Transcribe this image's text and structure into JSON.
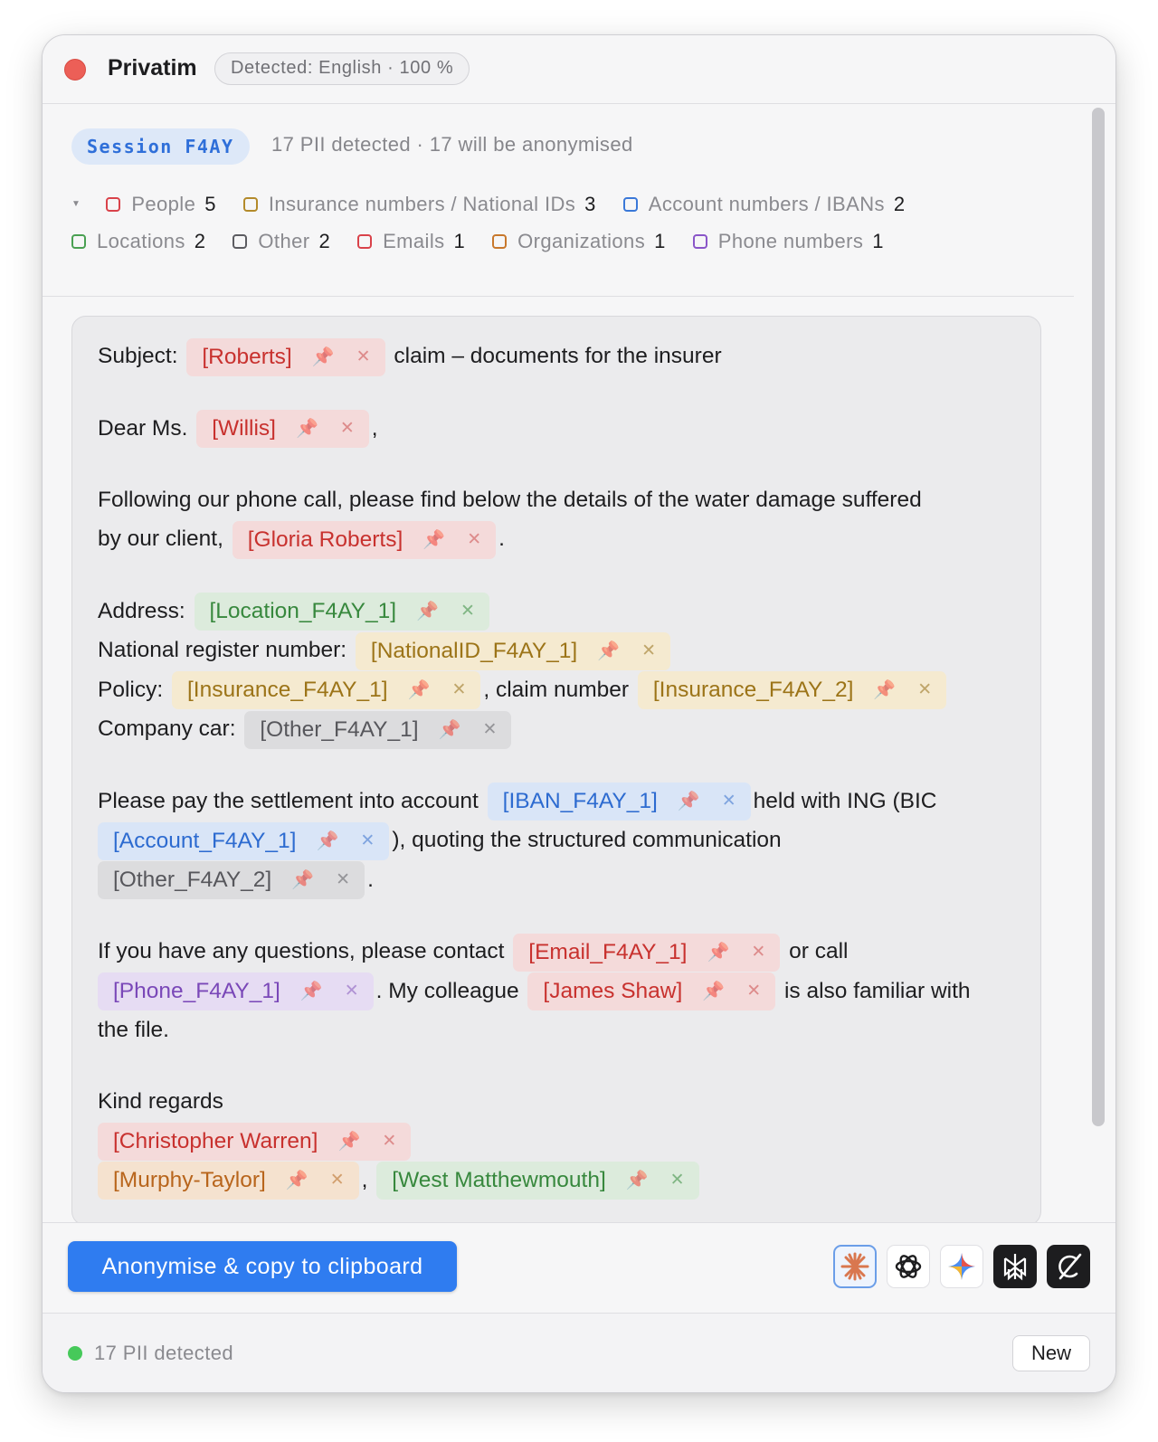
{
  "app": {
    "title": "Privatim",
    "detected": "Detected: English · 100 %"
  },
  "session": {
    "label": "Session F4AY",
    "summary": "17 PII detected · 17 will be anonymised"
  },
  "categories": [
    {
      "label": "People",
      "count": "5",
      "color": "#d9424a"
    },
    {
      "label": "Insurance numbers / National IDs",
      "count": "3",
      "color": "#b38a2a"
    },
    {
      "label": "Account numbers / IBANs",
      "count": "2",
      "color": "#3a78d8"
    },
    {
      "label": "Locations",
      "count": "2",
      "color": "#4aa052"
    },
    {
      "label": "Other",
      "count": "2",
      "color": "#5c5c61"
    },
    {
      "label": "Emails",
      "count": "1",
      "color": "#d9424a"
    },
    {
      "label": "Organizations",
      "count": "1",
      "color": "#c8782c"
    },
    {
      "label": "Phone numbers",
      "count": "1",
      "color": "#8a56c8"
    }
  ],
  "doc": {
    "subject_label": "Subject:",
    "subject_tok": "[Roberts]",
    "subject_rest": "claim – documents for the insurer",
    "greeting": "Dear Ms.",
    "greeting_tok": "[Willis]",
    "comma": ",",
    "p1_a": "Following our phone call, please find below the details of the water damage suffered",
    "p1_b": "by our client,",
    "p1_tok": "[Gloria Roberts]",
    "period": ".",
    "address_label": "Address:",
    "address_tok": "[Location_F4AY_1]",
    "national_label": "National register number:",
    "national_tok": "[NationalID_F4AY_1]",
    "policy_label": "Policy:",
    "policy_tok": "[Insurance_F4AY_1]",
    "claim_label": ", claim number",
    "claim_tok": "[Insurance_F4AY_2]",
    "car_label": "Company car:",
    "car_tok": "[Other_F4AY_1]",
    "pay_a": "Please pay the settlement into account",
    "iban_tok": "[IBAN_F4AY_1]",
    "pay_b": "held with ING (BIC",
    "acct_tok": "[Account_F4AY_1]",
    "pay_c": "), quoting the structured communication",
    "other2_tok": "[Other_F4AY_2]",
    "q_a": "If you have any questions, please contact",
    "email_tok": "[Email_F4AY_1]",
    "q_b": "or call",
    "phone_tok": "[Phone_F4AY_1]",
    "q_c": ". My colleague",
    "colleague_tok": "[James Shaw]",
    "q_d": "is also familiar with",
    "q_e": "the file.",
    "closing": "Kind regards",
    "sig_tok": "[Christopher Warren]",
    "org_tok": "[Murphy-Taylor]",
    "city_tok": "[West Matthewmouth]"
  },
  "icons": {
    "pin": "pin-icon",
    "remove": "remove-icon"
  },
  "actions": {
    "primary": "Anonymise & copy to clipboard",
    "assistants": [
      "claude-icon",
      "chatgpt-icon",
      "gemini-icon",
      "perplexity-icon",
      "grok-icon"
    ]
  },
  "status": {
    "text": "17 PII detected",
    "new_label": "New"
  }
}
